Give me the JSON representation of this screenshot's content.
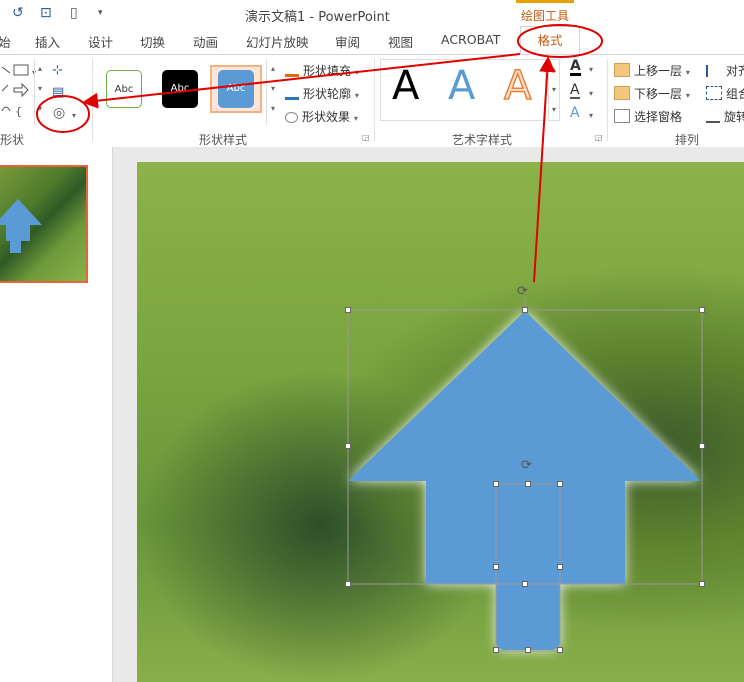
{
  "window": {
    "title": "演示文稿1 - PowerPoint",
    "context_tools": "绘图工具"
  },
  "tabs": [
    {
      "label": "始"
    },
    {
      "label": "插入"
    },
    {
      "label": "设计"
    },
    {
      "label": "切换"
    },
    {
      "label": "动画"
    },
    {
      "label": "幻灯片放映"
    },
    {
      "label": "审阅"
    },
    {
      "label": "视图"
    },
    {
      "label": "ACROBAT"
    }
  ],
  "active_tab": "格式",
  "ribbon": {
    "groups": {
      "shapes": "形状",
      "shape_styles": "形状样式",
      "wordart": "艺术字样式",
      "arrange": "排列"
    },
    "style_samples": [
      "Abc",
      "Abc",
      "Abc"
    ],
    "shape_fill": "形状填充",
    "shape_outline": "形状轮廓",
    "shape_effects": "形状效果",
    "wordart_letters": [
      "A",
      "A",
      "A"
    ],
    "text_fill_letter": "A",
    "text_outline_letter": "A",
    "text_effects_letter": "A",
    "bring_forward": "上移一层",
    "send_backward": "下移一层",
    "selection_pane": "选择窗格",
    "align": "对齐",
    "group": "组合",
    "rotate": "旋转"
  },
  "colors": {
    "accent": "#c55a11",
    "shape_fill": "#5b9bd5",
    "annotation": "#e00000",
    "thumb_border": "#e8623a"
  }
}
